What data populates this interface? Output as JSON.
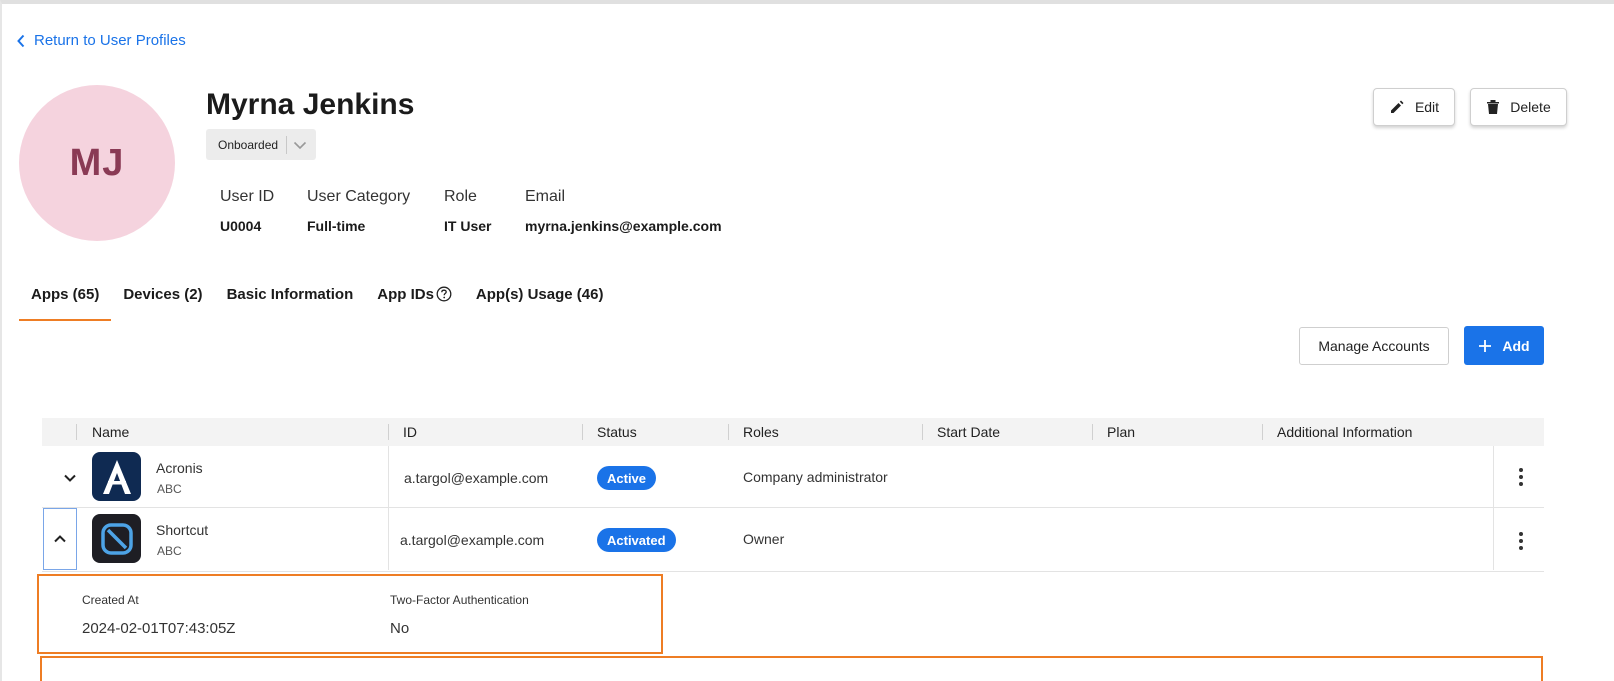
{
  "nav": {
    "back_label": "Return to User Profiles"
  },
  "profile": {
    "initials": "MJ",
    "name": "Myrna Jenkins",
    "status": "Onboarded",
    "fields": [
      {
        "label": "User ID",
        "value": "U0004"
      },
      {
        "label": "User Category",
        "value": "Full-time"
      },
      {
        "label": "Role",
        "value": "IT User"
      },
      {
        "label": "Email",
        "value": "myrna.jenkins@example.com"
      }
    ]
  },
  "actions": {
    "edit": "Edit",
    "delete": "Delete"
  },
  "tabs": [
    {
      "label": "Apps (65)",
      "active": true
    },
    {
      "label": "Devices (2)"
    },
    {
      "label": "Basic Information"
    },
    {
      "label": "App IDs"
    },
    {
      "label": "App(s) Usage (46)"
    }
  ],
  "toolbar": {
    "manage": "Manage Accounts",
    "add": "Add"
  },
  "table": {
    "columns": [
      "Name",
      "ID",
      "Status",
      "Roles",
      "Start Date",
      "Plan",
      "Additional Information"
    ],
    "rows": [
      {
        "name": "Acronis",
        "org": "ABC",
        "id": "a.targol@example.com",
        "status": "Active",
        "roles": "Company administrator",
        "expanded": false,
        "logo": "acronis-logo"
      },
      {
        "name": "Shortcut",
        "org": "ABC",
        "id": "a.targol@example.com",
        "status": "Activated",
        "roles": "Owner",
        "expanded": true,
        "logo": "shortcut-logo"
      }
    ],
    "details": [
      {
        "label": "Created At",
        "value": "2024-02-01T07:43:05Z"
      },
      {
        "label": "Two-Factor Authentication",
        "value": "No"
      }
    ]
  },
  "colors": {
    "accent": "#1a73e8",
    "tab_underline": "#ee7d24",
    "avatar_bg": "#f5d3de",
    "avatar_text": "#8a3a55"
  }
}
